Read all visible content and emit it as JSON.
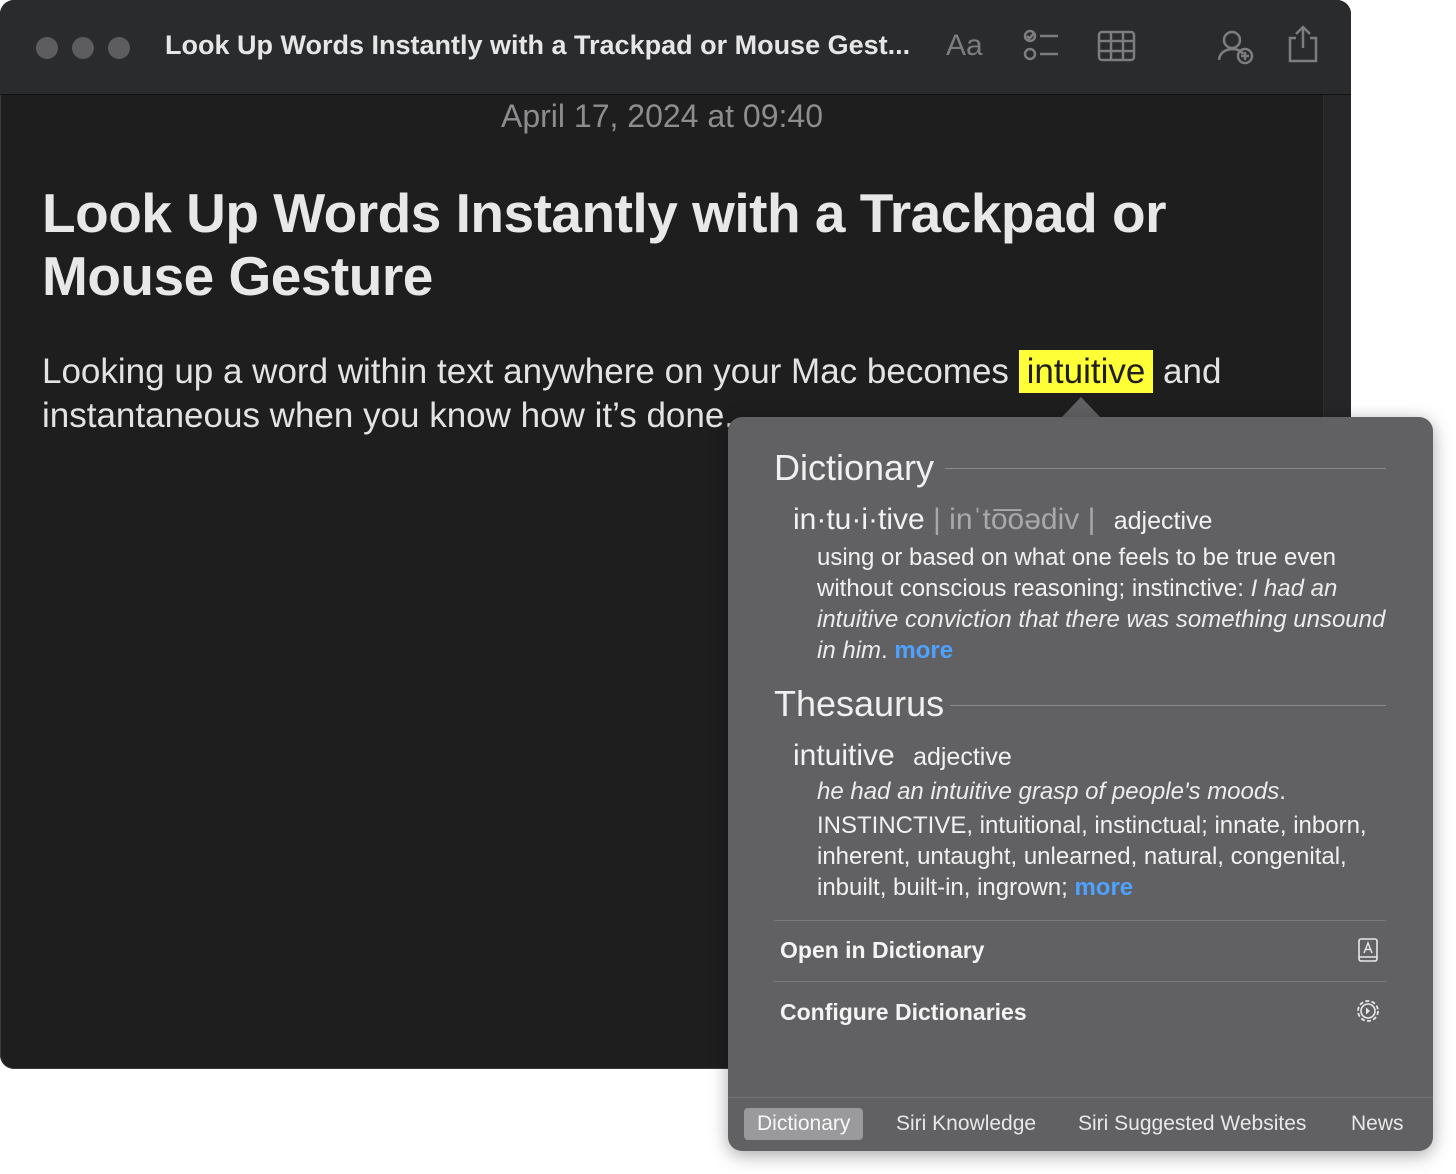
{
  "window": {
    "title": "Look Up Words Instantly with a Trackpad or Mouse Gest...",
    "toolbar": {
      "format_label": "Aa",
      "icons": [
        "checklist-icon",
        "table-icon",
        "collaborate-icon",
        "share-icon"
      ]
    }
  },
  "note": {
    "date": "April 17, 2024 at 09:40",
    "title": "Look Up Words Instantly with a Trackpad or Mouse Gesture",
    "body_before": "Looking up a word within text anywhere on your Mac becomes ",
    "highlight": "intuitive",
    "body_after": " and instantaneous when you know how it’s done."
  },
  "popover": {
    "dictionary": {
      "heading": "Dictionary",
      "headword": "in·tu·i·tive",
      "pronunciation": "| inˈto͞oədiv |",
      "part_of_speech": "adjective",
      "definition": "using or based on what one feels to be true even without conscious reasoning; instinctive:",
      "example": "I had an intuitive conviction that there was something unsound in him",
      "more": "more"
    },
    "thesaurus": {
      "heading": "Thesaurus",
      "headword": "intuitive",
      "part_of_speech": "adjective",
      "example": "he had an intuitive grasp of people's moods",
      "primary": "INSTINCTIVE",
      "synonyms": ", intuitional, instinctual; innate, inborn, inherent, untaught, unlearned, natural, congenital, inbuilt, built-in, ingrown;",
      "more": "more"
    },
    "actions": {
      "open_dictionary": "Open in Dictionary",
      "configure": "Configure Dictionaries"
    },
    "tabs": [
      "Dictionary",
      "Siri Knowledge",
      "Siri Suggested Websites",
      "News"
    ],
    "active_tab": "Dictionary"
  },
  "colors": {
    "highlight": "#ffff38",
    "link": "#4ea2ff",
    "popover_bg": "#616163",
    "window_bg": "#1e1e1e"
  }
}
